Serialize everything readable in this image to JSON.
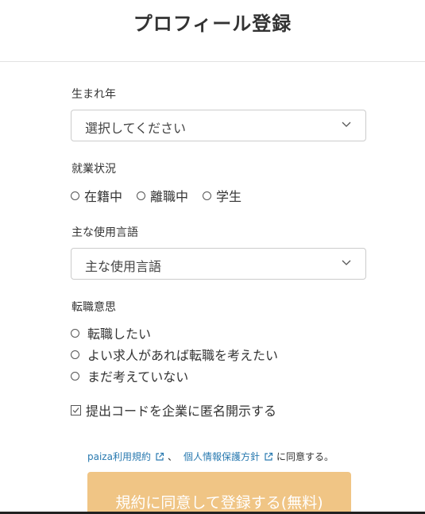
{
  "page": {
    "title": "プロフィール登録"
  },
  "birth_year": {
    "label": "生まれ年",
    "selected": "選択してください"
  },
  "employment": {
    "label": "就業状況",
    "options": [
      "在籍中",
      "離職中",
      "学生"
    ]
  },
  "language": {
    "label": "主な使用言語",
    "selected": "主な使用言語"
  },
  "job_change": {
    "label": "転職意思",
    "options": [
      "転職したい",
      "よい求人があれば転職を考えたい",
      "まだ考えていない"
    ]
  },
  "disclose": {
    "label": "提出コードを企業に匿名開示する",
    "checked": false
  },
  "terms": {
    "terms_link": "paiza利用規約",
    "separator": "、",
    "privacy_link": "個人情報保護方針",
    "suffix": "に同意する。"
  },
  "submit": {
    "label": "規約に同意して登録する(無料)"
  },
  "colors": {
    "link": "#2a7ab0",
    "button": "#f0c585",
    "text": "#333333"
  }
}
